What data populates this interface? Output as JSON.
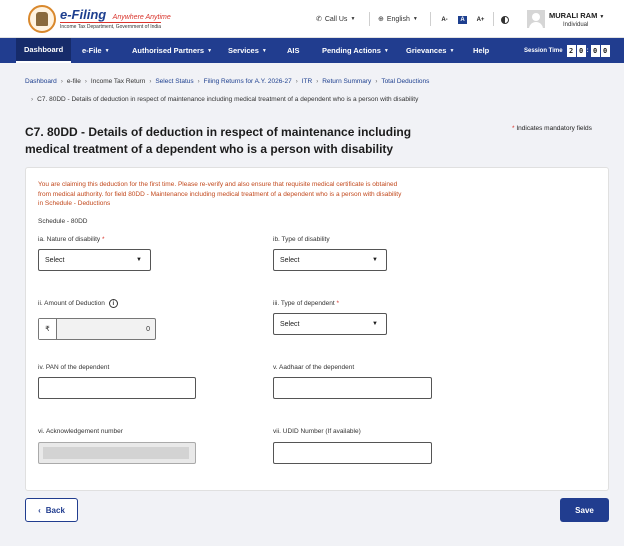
{
  "header": {
    "brand_name": "e-Filing",
    "brand_tagline": "Anywhere Anytime",
    "brand_sub": "Income Tax Department, Government of India",
    "call_us": "Call Us",
    "language": "English",
    "text_size": [
      "A-",
      "A",
      "A+"
    ],
    "user_name": "MURALI RAM",
    "user_role": "Individual"
  },
  "nav": {
    "items": [
      {
        "label": "Dashboard",
        "active": true
      },
      {
        "label": "e-File"
      },
      {
        "label": "Authorised Partners"
      },
      {
        "label": "Services"
      },
      {
        "label": "AIS"
      },
      {
        "label": "Pending Actions"
      },
      {
        "label": "Grievances"
      },
      {
        "label": "Help"
      }
    ],
    "session_label": "Session Time",
    "session_digits": [
      "2",
      "0",
      "0",
      "0"
    ]
  },
  "breadcrumb": {
    "items": [
      "Dashboard",
      "e-file",
      "Income Tax Return",
      "Select Status",
      "Filing Returns for A.Y. 2026-27",
      "ITR",
      "Return Summary",
      "Total Deductions"
    ],
    "current": "C7. 80DD - Details of deduction in respect of maintenance including medical treatment of a dependent who is a person with disability"
  },
  "page": {
    "title": "C7. 80DD - Details of deduction in respect of maintenance including medical treatment of a dependent who is a person with disability",
    "mandatory_note": "Indicates mandatory fields"
  },
  "form": {
    "warning": "You are claiming this deduction for the first time. Please re-verify and also ensure that requisite medical certificate is obtained from medical authority. for field 80DD - Maintenance including medical treatment of a dependent who is a person with disability in Schedule - Deductions",
    "schedule": "Schedule - 80DD",
    "nature_label": "ia. Nature of disability",
    "nature_value": "Select",
    "type_label": "ib. Type of disability",
    "type_value": "Select",
    "amount_label": "ii. Amount of Deduction",
    "currency": "₹",
    "amount_value": "0",
    "dependent_label": "iii. Type of dependent",
    "dependent_value": "Select",
    "pan_label": "iv. PAN of the dependent",
    "aadhaar_label": "v. Aadhaar of the dependent",
    "ack_label": "vi. Acknowledgement number",
    "udid_label": "vii. UDID Number (If available)"
  },
  "actions": {
    "back": "Back",
    "save": "Save"
  }
}
